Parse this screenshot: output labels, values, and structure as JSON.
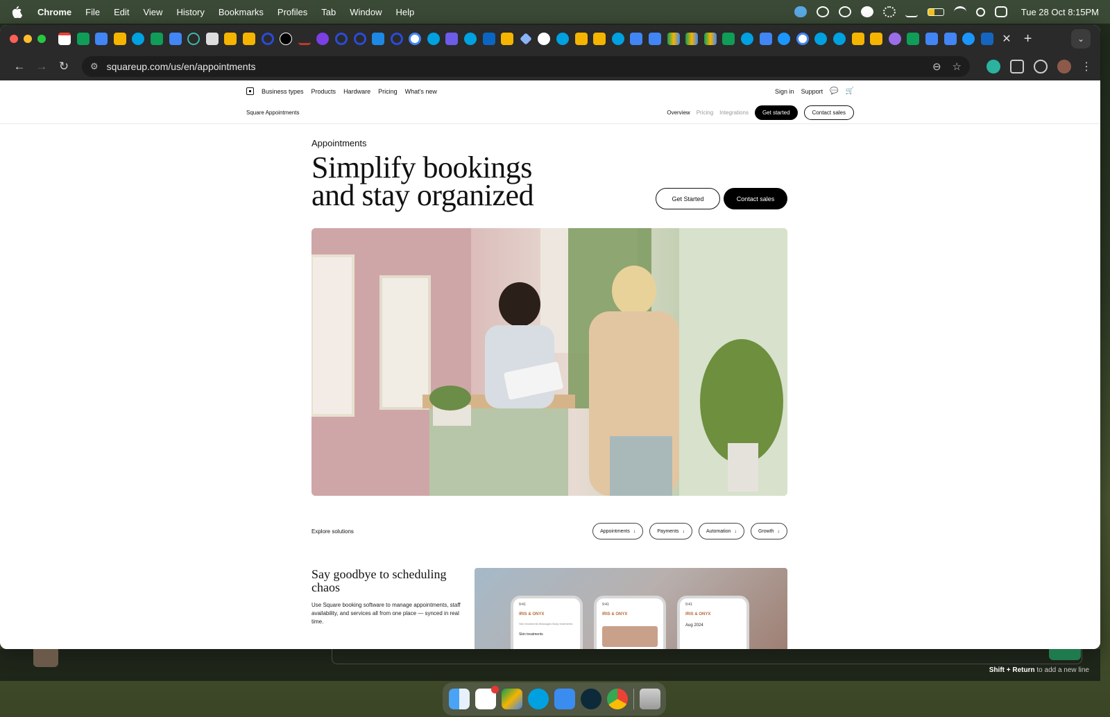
{
  "menubar": {
    "app_name": "Chrome",
    "menus": [
      "File",
      "Edit",
      "View",
      "History",
      "Bookmarks",
      "Profiles",
      "Tab",
      "Window",
      "Help"
    ],
    "clock": "Tue 28 Oct  8:15PM"
  },
  "browser": {
    "url": "squareup.com/us/en/appointments"
  },
  "site": {
    "top_nav": {
      "links": [
        "Business types",
        "Products",
        "Hardware",
        "Pricing",
        "What's new"
      ],
      "sign_in": "Sign in",
      "support": "Support"
    },
    "sub_nav": {
      "product_name": "Square Appointments",
      "links": [
        "Overview",
        "Pricing",
        "Integrations"
      ],
      "get_started": "Get started",
      "contact_sales": "Contact sales"
    },
    "hero": {
      "eyebrow": "Appointments",
      "headline_line1": "Simplify bookings",
      "headline_line2": "and stay organized",
      "cta_primary": "Get Started",
      "cta_secondary": "Contact sales"
    },
    "solutions": {
      "label": "Explore solutions",
      "chips": [
        "Appointments",
        "Payments",
        "Automation",
        "Growth"
      ]
    },
    "feature": {
      "title": "Say goodbye to scheduling chaos",
      "description": "Use Square booking software to manage appointments, staff availability, and services all from one place — synced in real time.",
      "phone_time": "9:41",
      "phone_brand": "IRIS & ONYX",
      "phone1_tabs": "Skin treatments   Massages   Body treatments",
      "phone1_sub": "Skin treatments",
      "phone3_month": "Aug 2024"
    }
  },
  "chat": {
    "hint_key": "Shift + Return",
    "hint_text": " to add a new line"
  },
  "colors": {
    "menubar_bg": "#3b4a36",
    "chrome_dark": "#2a2a2a",
    "brand_black": "#000000",
    "phone_brand": "#b36a3c"
  }
}
